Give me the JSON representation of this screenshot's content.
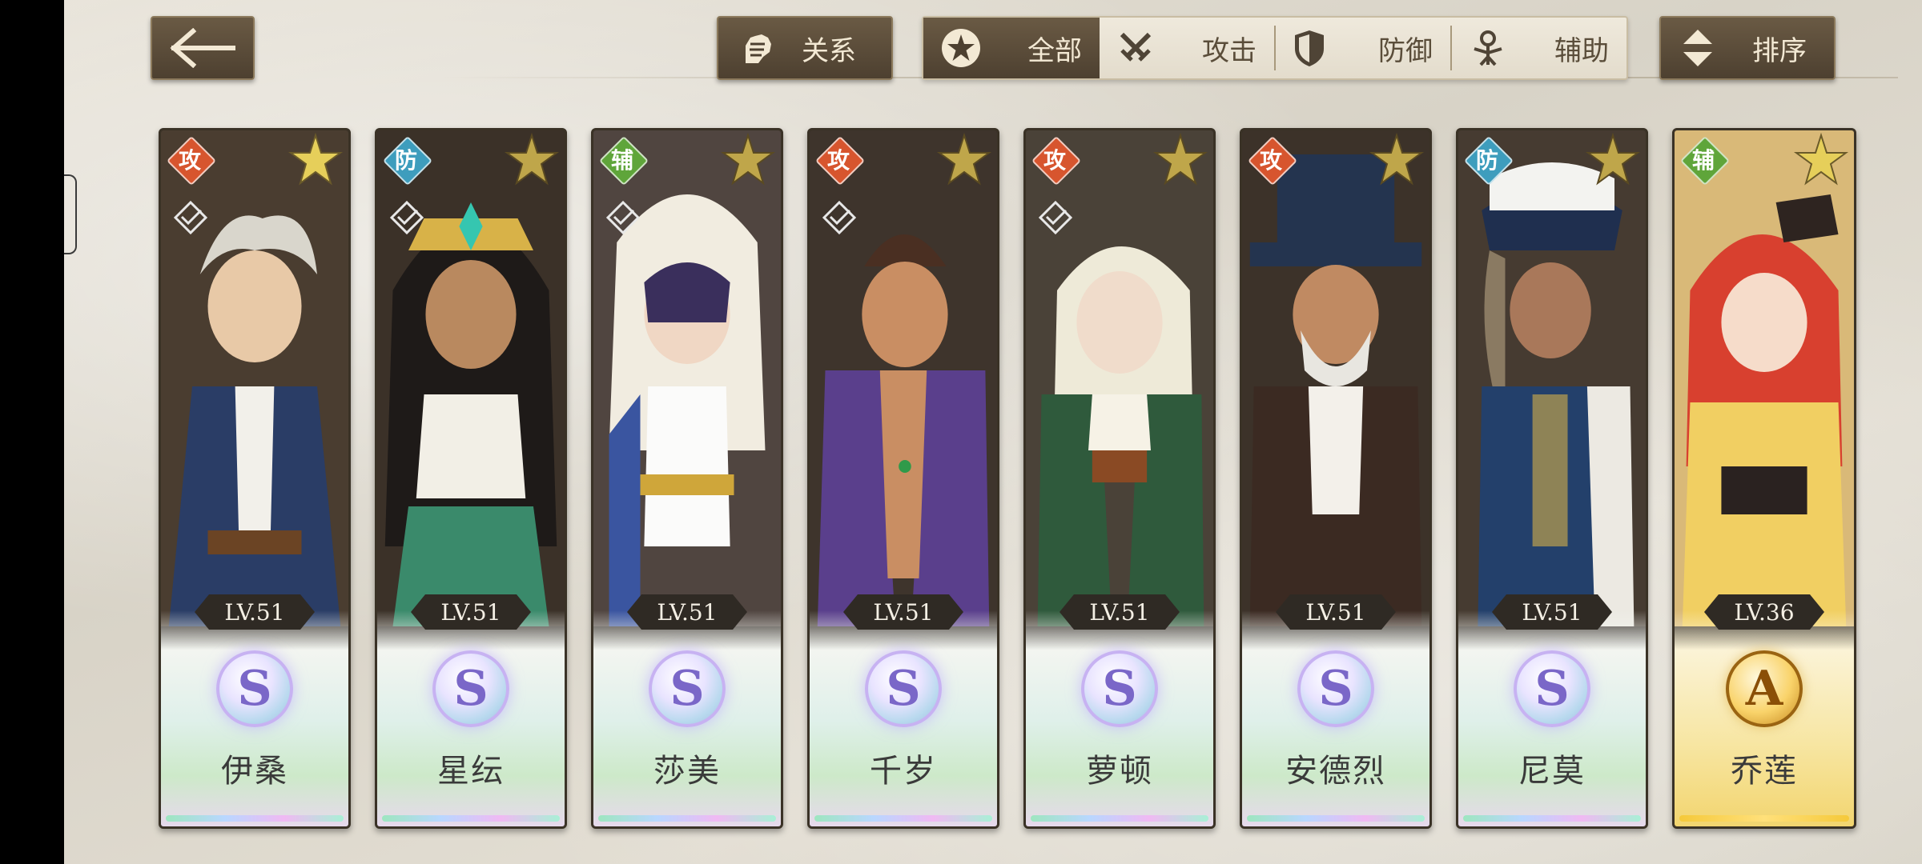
{
  "header": {
    "back_icon": "arrow-left-icon",
    "relation_label": "关系",
    "sort_label": "排序",
    "filters": [
      {
        "label": "全部",
        "icon": "star-circle-icon",
        "active": true
      },
      {
        "label": "攻击",
        "icon": "crossed-swords-icon",
        "active": false
      },
      {
        "label": "防御",
        "icon": "shield-icon",
        "active": false
      },
      {
        "label": "辅助",
        "icon": "support-figure-icon",
        "active": false
      }
    ]
  },
  "heroes": [
    {
      "name": "伊桑",
      "role": "攻",
      "level": "LV.51",
      "grade": "S"
    },
    {
      "name": "星纭",
      "role": "防",
      "level": "LV.51",
      "grade": "S"
    },
    {
      "name": "莎美",
      "role": "辅",
      "level": "LV.51",
      "grade": "S"
    },
    {
      "name": "千岁",
      "role": "攻",
      "level": "LV.51",
      "grade": "S"
    },
    {
      "name": "萝顿",
      "role": "攻",
      "level": "LV.51",
      "grade": "S"
    },
    {
      "name": "安德烈",
      "role": "攻",
      "level": "LV.51",
      "grade": "S"
    },
    {
      "name": "尼莫",
      "role": "防",
      "level": "LV.51",
      "grade": "S"
    },
    {
      "name": "乔莲",
      "role": "辅",
      "level": "LV.36",
      "grade": "A"
    }
  ],
  "colors": {
    "attack": "#d7552e",
    "defense": "#3e9dbd",
    "support": "#5fa53a",
    "button_dark": "#4d4030",
    "grade_a_gold": "#f2d46c"
  }
}
